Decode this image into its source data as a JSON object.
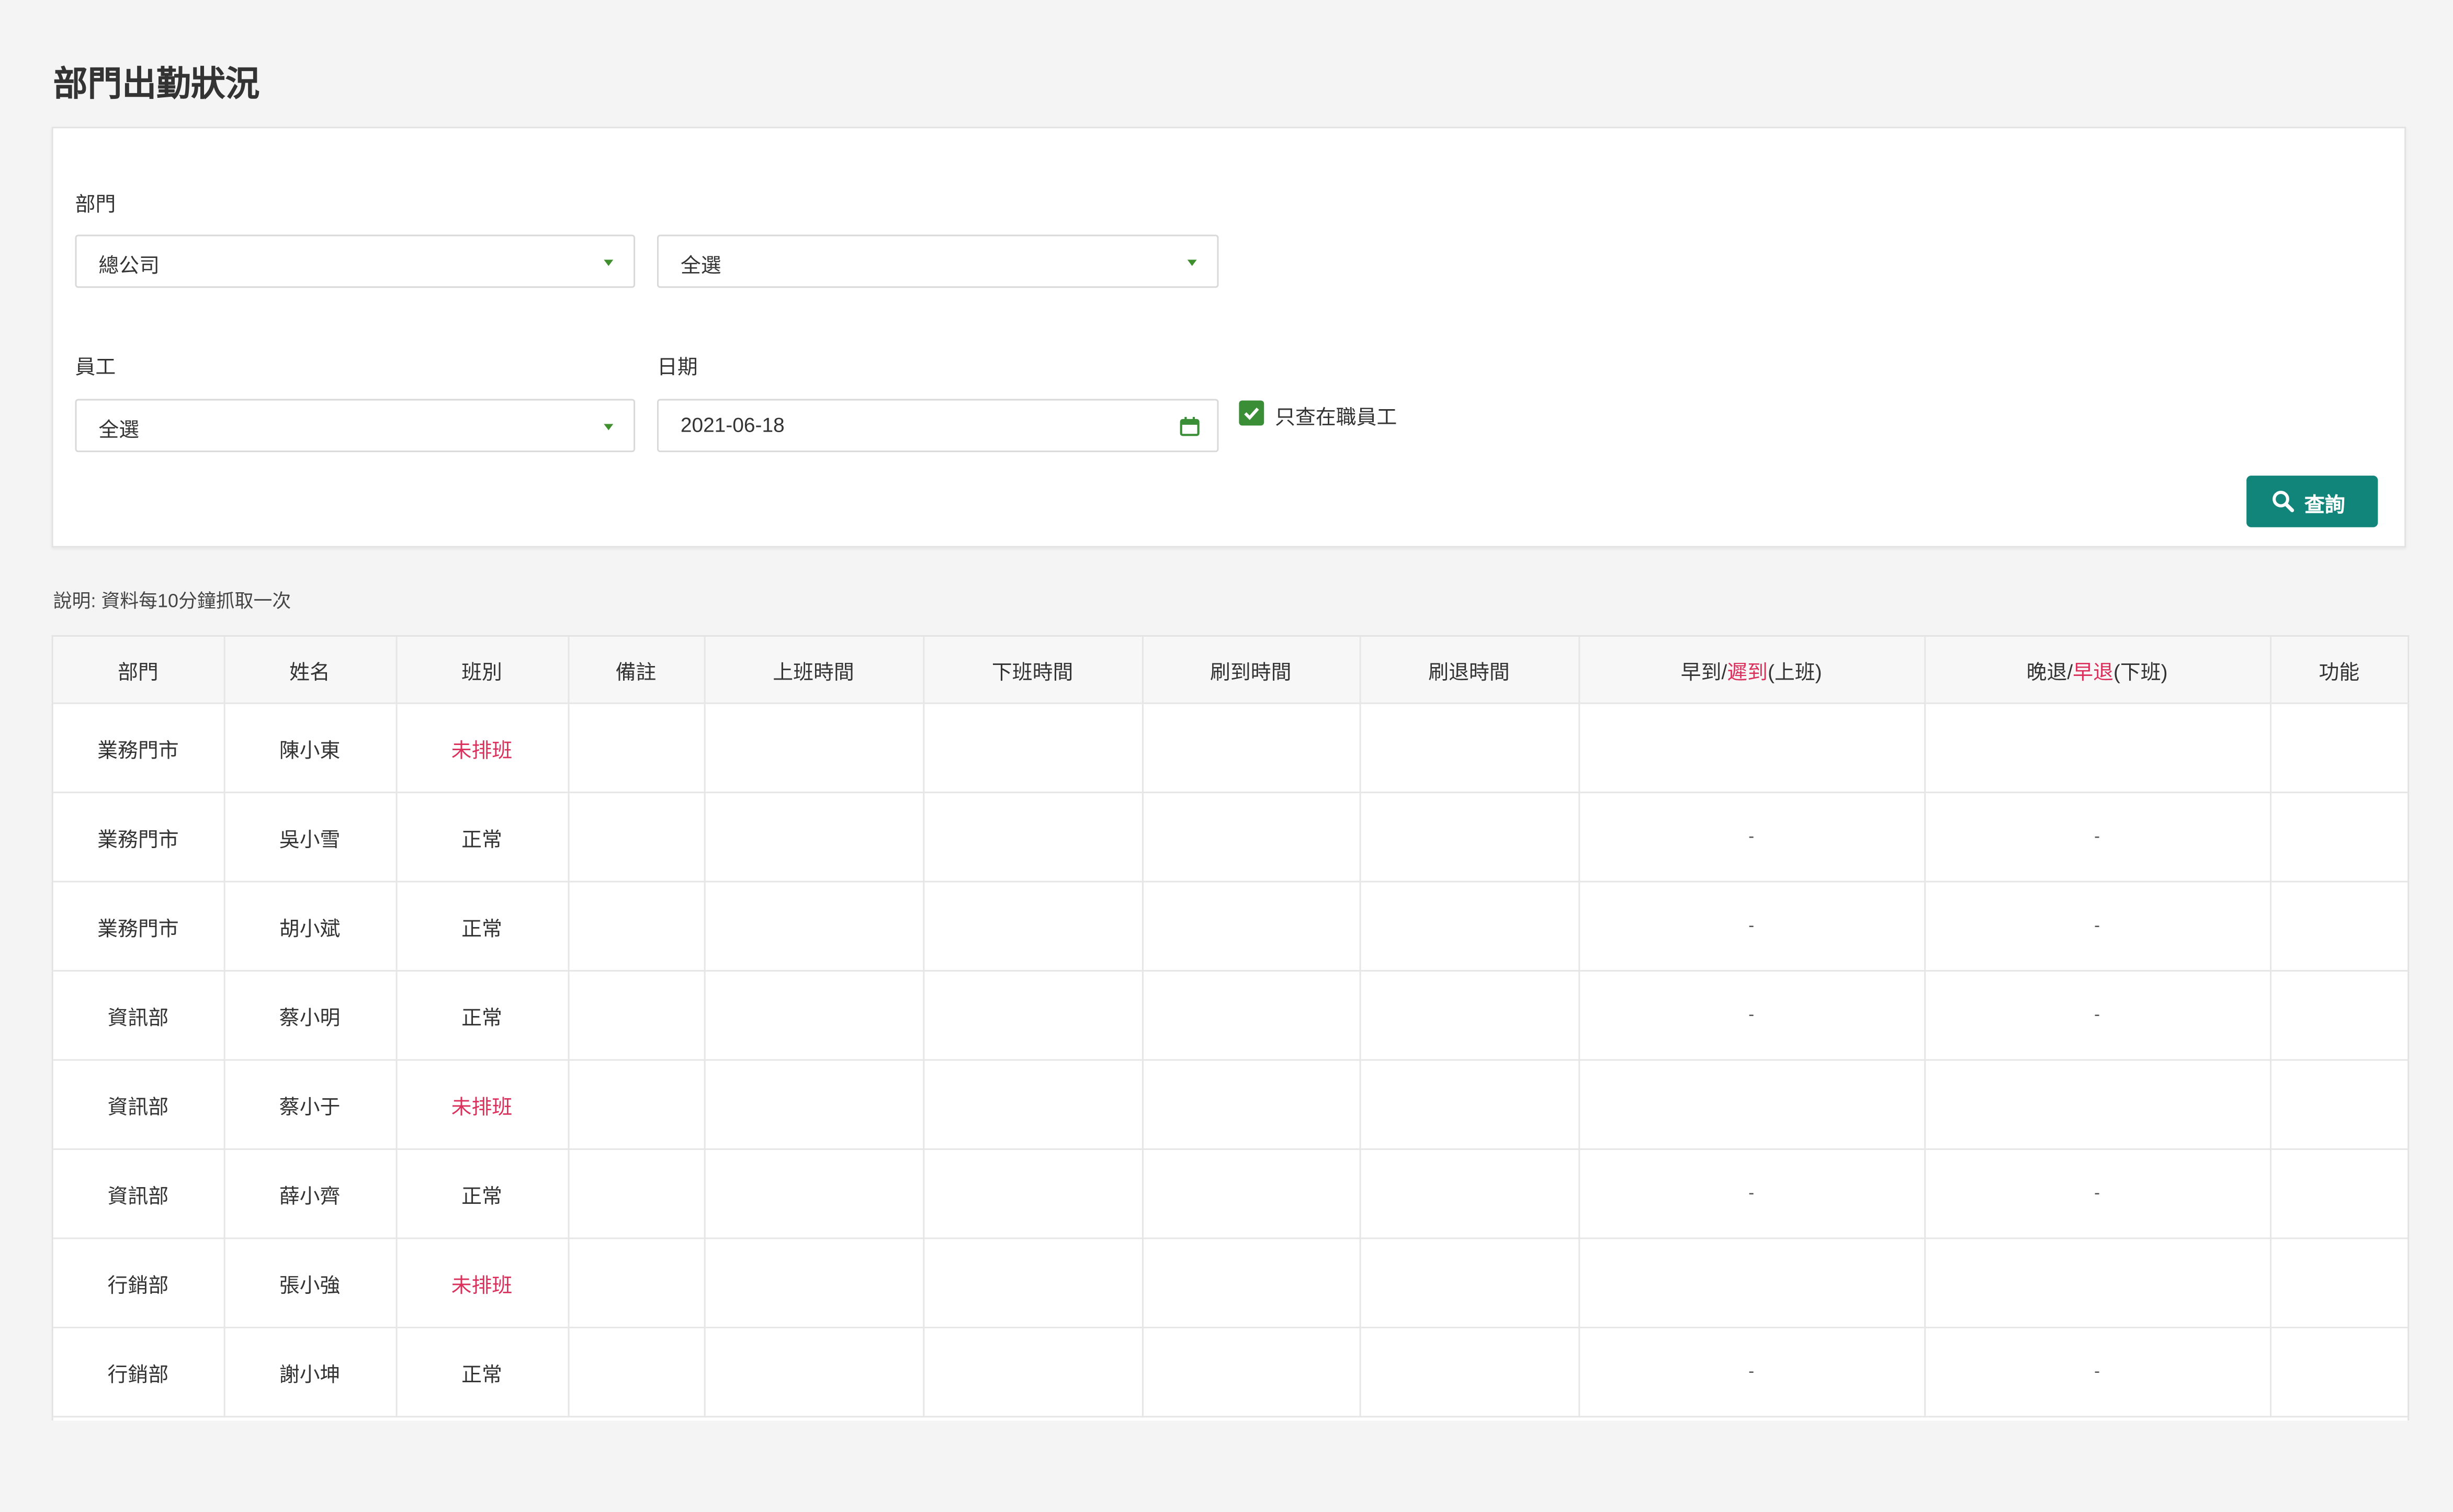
{
  "page": {
    "title": "部門出勤狀況"
  },
  "filters": {
    "department_label": "部門",
    "department_value": "總公司",
    "sub_department_value": "全選",
    "employee_label": "員工",
    "employee_value": "全選",
    "date_label": "日期",
    "date_value": "2021-06-18",
    "only_active_label": "只查在職員工",
    "only_active_checked": true,
    "query_button": "查詢"
  },
  "note": "說明: 資料每10分鐘抓取一次",
  "table": {
    "headers": {
      "dept": "部門",
      "name": "姓名",
      "shift": "班別",
      "remark": "備註",
      "start_time": "上班時間",
      "end_time": "下班時間",
      "clock_in": "刷到時間",
      "clock_out": "刷退時間",
      "early_late_a": "早到/",
      "early_late_b": "遲到",
      "early_late_c": "(上班)",
      "late_early_a": "晚退/",
      "late_early_b": "早退",
      "late_early_c": "(下班)",
      "action": "功能"
    },
    "rows": [
      {
        "dept": "業務門市",
        "name": "陳小東",
        "shift": "未排班",
        "unscheduled": true,
        "early_late": "",
        "late_early": ""
      },
      {
        "dept": "業務門市",
        "name": "吳小雪",
        "shift": "正常",
        "unscheduled": false,
        "early_late": "-",
        "late_early": "-"
      },
      {
        "dept": "業務門市",
        "name": "胡小斌",
        "shift": "正常",
        "unscheduled": false,
        "early_late": "-",
        "late_early": "-"
      },
      {
        "dept": "資訊部",
        "name": "蔡小明",
        "shift": "正常",
        "unscheduled": false,
        "early_late": "-",
        "late_early": "-"
      },
      {
        "dept": "資訊部",
        "name": "蔡小于",
        "shift": "未排班",
        "unscheduled": true,
        "early_late": "",
        "late_early": ""
      },
      {
        "dept": "資訊部",
        "name": "薛小齊",
        "shift": "正常",
        "unscheduled": false,
        "early_late": "-",
        "late_early": "-"
      },
      {
        "dept": "行銷部",
        "name": "張小強",
        "shift": "未排班",
        "unscheduled": true,
        "early_late": "",
        "late_early": ""
      },
      {
        "dept": "行銷部",
        "name": "謝小坤",
        "shift": "正常",
        "unscheduled": false,
        "early_late": "-",
        "late_early": "-"
      }
    ]
  },
  "colors": {
    "accent_green": "#3a8e36",
    "button_teal": "#11857a",
    "unscheduled_red": "#d9315b"
  }
}
